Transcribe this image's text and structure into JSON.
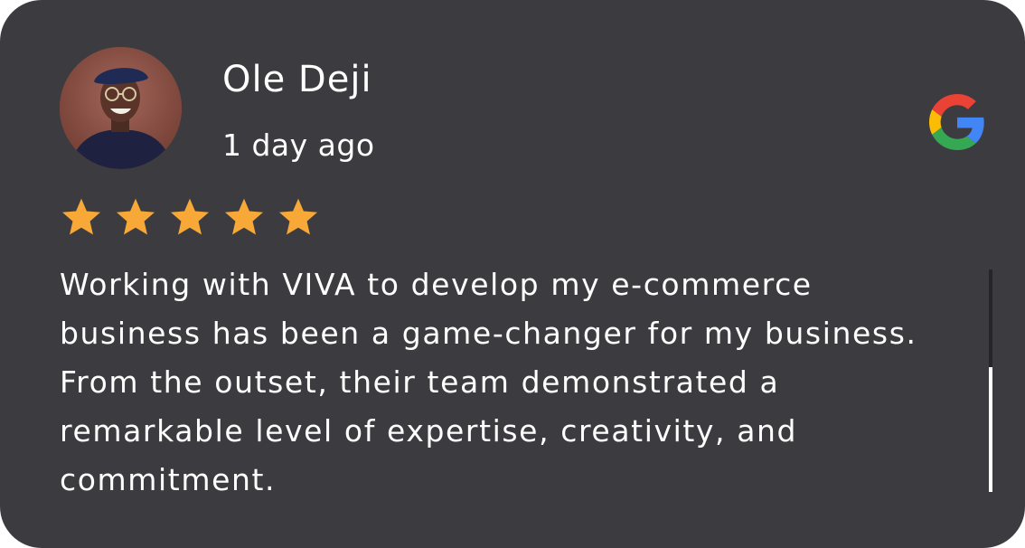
{
  "review": {
    "author_name": "Ole Deji",
    "time_ago": "1 day ago",
    "rating": 5,
    "rating_max": 5,
    "text": "Working with VIVA to develop my e-commerce business has been a game-changer for my business. From the outset, their team demonstrated a remarkable level of expertise, creativity, and commitment.",
    "source_icon": "google-icon"
  },
  "colors": {
    "card_background": "#3c3c40",
    "text": "#ffffff",
    "star": "#f7a837",
    "google_red": "#ea4335",
    "google_yellow": "#fbbc05",
    "google_green": "#34a853",
    "google_blue": "#4285f4"
  },
  "scrollbar": {
    "scroll_position_fraction": 1.0,
    "visible_fraction": 0.56
  }
}
